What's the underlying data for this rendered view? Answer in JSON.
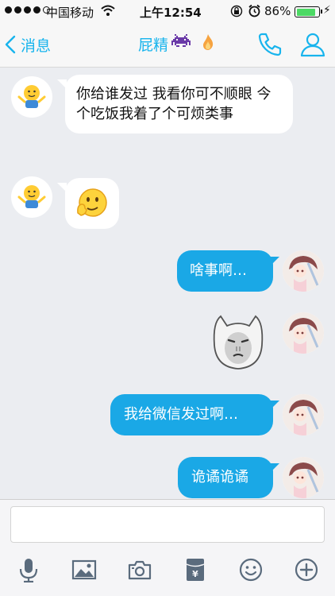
{
  "status_bar": {
    "carrier": "中国移动",
    "time": "上午12:54",
    "battery_percent": "86%",
    "battery_level": 0.86,
    "icons": [
      "signal-dots",
      "wifi-icon",
      "orientation-lock-icon",
      "alarm-icon",
      "battery-icon",
      "charging-icon"
    ]
  },
  "nav": {
    "back_label": "消息",
    "title": "屁精",
    "title_emoji": "👾",
    "accent_color": "#18b4ed",
    "icons": [
      "back-chevron-icon",
      "flame-icon",
      "phone-icon",
      "profile-icon"
    ]
  },
  "messages": [
    {
      "direction": "in",
      "type": "text",
      "text": " 你给谁发过 我看你可不顺眼 今个吃饭我着了个可烦类事"
    },
    {
      "direction": "in",
      "type": "sticker",
      "sticker": "thinking-face-sticker"
    },
    {
      "direction": "out",
      "type": "text",
      "text": "啥事啊…"
    },
    {
      "direction": "out",
      "type": "sticker",
      "sticker": "cat-face-meme-sticker"
    },
    {
      "direction": "out",
      "type": "text",
      "text": "我给微信发过啊…"
    },
    {
      "direction": "out",
      "type": "text",
      "text": "诡谲诡谲"
    }
  ],
  "colors": {
    "outgoing_bubble": "#1aa8e6",
    "incoming_bubble": "#ffffff",
    "chat_background": "#ebedf1"
  },
  "input": {
    "placeholder": "",
    "value": ""
  },
  "toolbar": {
    "icons": [
      "microphone-icon",
      "image-icon",
      "camera-icon",
      "red-packet-icon",
      "emoji-icon",
      "plus-icon"
    ]
  }
}
